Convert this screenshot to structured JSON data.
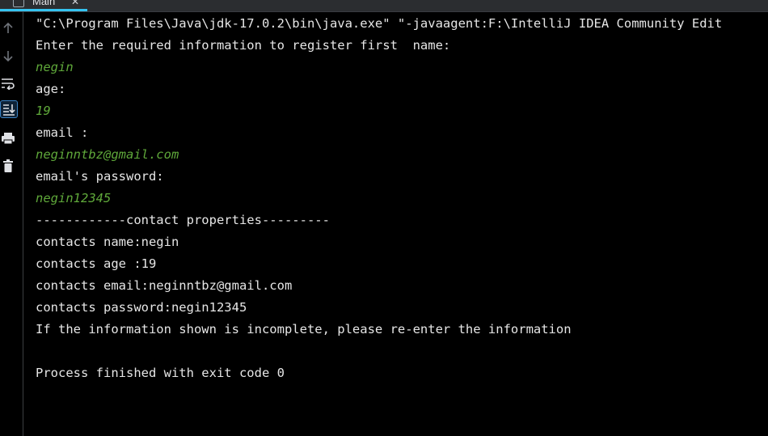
{
  "run_tab": {
    "label": "Main",
    "close": "✕"
  },
  "toolbar": {
    "tools": [
      {
        "name": "up-arrow-icon"
      },
      {
        "name": "down-arrow-icon"
      },
      {
        "name": "soft-wrap-icon"
      },
      {
        "name": "scroll-to-end-icon"
      },
      {
        "name": "print-icon"
      },
      {
        "name": "trash-icon"
      }
    ]
  },
  "console": {
    "lines": [
      {
        "text": "\"C:\\Program Files\\Java\\jdk-17.0.2\\bin\\java.exe\" \"-javaagent:F:\\IntelliJ IDEA Community Edit",
        "kind": "output"
      },
      {
        "text": "Enter the required information to register first  name:",
        "kind": "output"
      },
      {
        "text": "negin",
        "kind": "input"
      },
      {
        "text": "age:",
        "kind": "output"
      },
      {
        "text": "19",
        "kind": "input"
      },
      {
        "text": "email :",
        "kind": "output"
      },
      {
        "text": "neginntbz@gmail.com",
        "kind": "input"
      },
      {
        "text": "email's password:",
        "kind": "output"
      },
      {
        "text": "negin12345",
        "kind": "input"
      },
      {
        "text": "------------contact properties---------",
        "kind": "output"
      },
      {
        "text": "contacts name:negin",
        "kind": "output"
      },
      {
        "text": "contacts age :19",
        "kind": "output"
      },
      {
        "text": "contacts email:neginntbz@gmail.com",
        "kind": "output"
      },
      {
        "text": "contacts password:negin12345",
        "kind": "output"
      },
      {
        "text": "If the information shown is incomplete, please re-enter the information",
        "kind": "output"
      },
      {
        "text": "",
        "kind": "output"
      },
      {
        "text": "Process finished with exit code 0",
        "kind": "output"
      }
    ]
  },
  "colors": {
    "background": "#000000",
    "output_text": "#e6e6e6",
    "user_input_text": "#5fa83a",
    "tab_accent": "#35c4f0"
  }
}
